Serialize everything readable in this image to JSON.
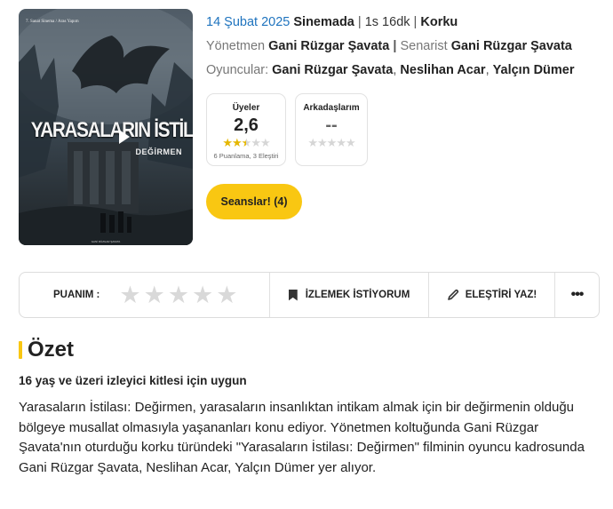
{
  "poster": {
    "top_text": "7. Sanat Sinema / Aras Yapım",
    "title": "YARASALARIN İSTİLASI",
    "subtitle": "DEĞİRMEN",
    "bottom_text": "GANİ RÜZGAR ŞAVATA"
  },
  "movie": {
    "release_date": "14 Şubat 2025",
    "release_status": "Sinemada",
    "duration": "1s 16dk",
    "genre": "Korku",
    "director_label": "Yönetmen",
    "director": "Gani Rüzgar Şavata",
    "writer_label": "Senarist",
    "writer": "Gani Rüzgar Şavata",
    "cast_label": "Oyuncular:",
    "cast": [
      "Gani Rüzgar Şavata",
      "Neslihan Acar",
      "Yalçın Dümer"
    ]
  },
  "ratings": {
    "users": {
      "label": "Üyeler",
      "score": "2,6",
      "stars_value": 2.6,
      "stars_max": 5,
      "count_text": "6 Puanlama, 3 Eleştiri"
    },
    "friends": {
      "label": "Arkadaşlarım",
      "score": "--",
      "stars_value": 0,
      "stars_max": 5
    }
  },
  "seans_button": "Seanslar! (4)",
  "action_bar": {
    "rate_label": "PUANIM :",
    "rate_stars": 5,
    "watchlist_label": "İZLEMEK İSTİYORUM",
    "review_label": "ELEŞTİRİ YAZ!",
    "more_label": "•••"
  },
  "summary": {
    "title": "Özet",
    "age_rating": "16 yaş ve üzeri izleyici kitlesi için uygun",
    "text": "Yarasaların İstilası: Değirmen, yarasaların insanlıktan intikam almak için bir değirmenin olduğu bölgeye musallat olmasıyla yaşananları konu ediyor. Yönetmen koltuğunda Gani Rüzgar Şavata'nın oturduğu korku türündeki \"Yarasaların İstilası: Değirmen\" filminin oyuncu kadrosunda Gani Rüzgar Şavata, Neslihan Acar, Yalçın Dümer yer alıyor."
  },
  "colors": {
    "accent_yellow": "#f9c712",
    "link_blue": "#1e73be",
    "star_gold": "#e5b700"
  }
}
